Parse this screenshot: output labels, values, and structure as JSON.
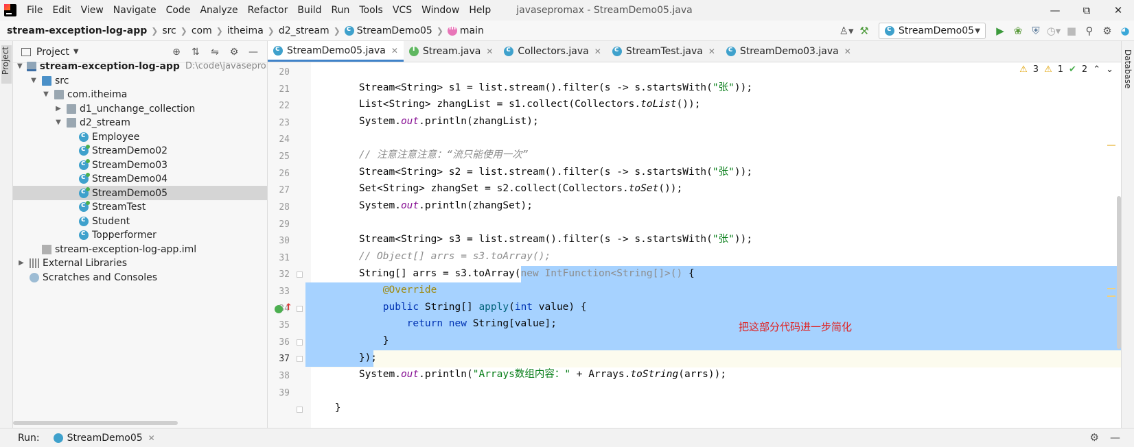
{
  "menu": [
    "File",
    "Edit",
    "View",
    "Navigate",
    "Code",
    "Analyze",
    "Refactor",
    "Build",
    "Run",
    "Tools",
    "VCS",
    "Window",
    "Help"
  ],
  "window_title": "javasepromax - StreamDemo05.java",
  "breadcrumb": [
    "stream-exception-log-app",
    "src",
    "com",
    "itheima",
    "d2_stream",
    "StreamDemo05",
    "main"
  ],
  "run_config": "StreamDemo05",
  "project_panel": {
    "title": "Project",
    "stripe_label": "Project",
    "tree": [
      {
        "label": "stream-exception-log-app",
        "path": "D:\\code\\javasepromax\\"
      },
      {
        "label": "src"
      },
      {
        "label": "com.itheima"
      },
      {
        "label": "d1_unchange_collection"
      },
      {
        "label": "d2_stream"
      },
      {
        "label": "Employee"
      },
      {
        "label": "StreamDemo02"
      },
      {
        "label": "StreamDemo03"
      },
      {
        "label": "StreamDemo04"
      },
      {
        "label": "StreamDemo05"
      },
      {
        "label": "StreamTest"
      },
      {
        "label": "Student"
      },
      {
        "label": "Topperformer"
      },
      {
        "label": "stream-exception-log-app.iml"
      },
      {
        "label": "External Libraries"
      },
      {
        "label": "Scratches and Consoles"
      }
    ]
  },
  "editor_tabs": [
    "StreamDemo05.java",
    "Stream.java",
    "Collectors.java",
    "StreamTest.java",
    "StreamDemo03.java"
  ],
  "right_stripe_label": "Database",
  "inspections": {
    "warnings": "3",
    "weak": "1",
    "ok": "2"
  },
  "line_numbers": [
    "20",
    "21",
    "22",
    "23",
    "24",
    "25",
    "26",
    "27",
    "28",
    "29",
    "30",
    "31",
    "32",
    "33",
    "34",
    "35",
    "36",
    "37",
    "38",
    "39"
  ],
  "code": {
    "l21": {
      "a": "        Stream<String> s1 = list.stream().filter(s -> s.startsWith(",
      "str": "\"张\"",
      "b": "));"
    },
    "l22": {
      "a": "        List<String> zhangList = s1.collect(Collectors.",
      "it": "toList",
      "b": "());"
    },
    "l23": {
      "a": "        System.",
      "st": "out",
      "b": ".println(zhangList);"
    },
    "l25": "        // 注意注意注意：“流只能使用一次”",
    "l26": {
      "a": "        Stream<String> s2 = list.stream().filter(s -> s.startsWith(",
      "str": "\"张\"",
      "b": "));"
    },
    "l27": {
      "a": "        Set<String> zhangSet = s2.collect(Collectors.",
      "it": "toSet",
      "b": "());"
    },
    "l28": {
      "a": "        System.",
      "st": "out",
      "b": ".println(zhangSet);"
    },
    "l30": {
      "a": "        Stream<String> s3 = list.stream().filter(s -> s.startsWith(",
      "str": "\"张\"",
      "b": "));"
    },
    "l31": "        // Object[] arrs = s3.toArray();",
    "l32": {
      "a": "        String[] arrs = s3.toArray(",
      "gr": "new IntFunction<String[]>() ",
      "b": "{"
    },
    "l33": "            @Override",
    "l34": {
      "kw": "            public ",
      "a": "String[] ",
      "fn": "apply",
      "b": "(",
      "kw2": "int ",
      "c": "value) {"
    },
    "l35": {
      "kw": "                return new ",
      "a": "String[value];"
    },
    "l36": "            }",
    "l37": "        });",
    "l38": {
      "a": "        System.",
      "st": "out",
      "b": ".println(",
      "str": "\"Arrays数组内容：\"",
      "c": " + Arrays.",
      "it": "toString",
      "d": "(arrs));"
    },
    "l40": "    }"
  },
  "annotation_note": "把这部分代码进一步简化",
  "run_bar": {
    "label": "Run:",
    "tab": "StreamDemo05"
  }
}
